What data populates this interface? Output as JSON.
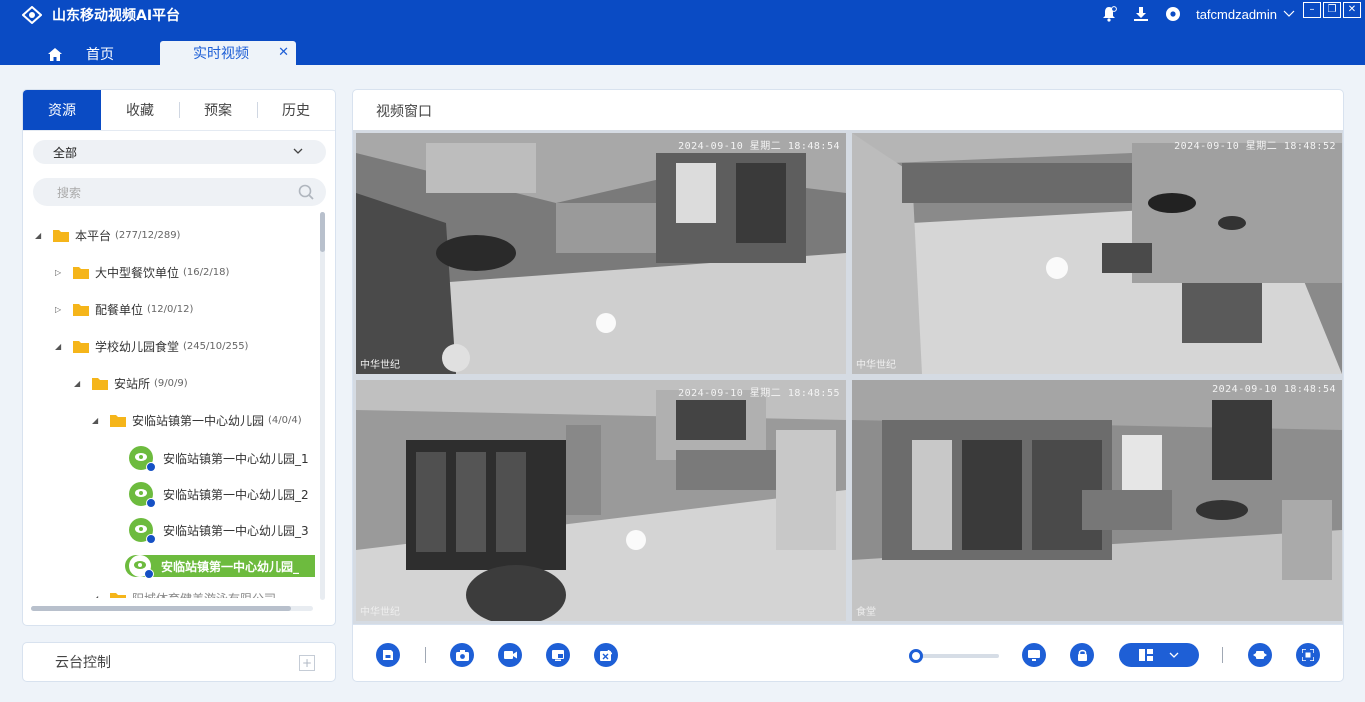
{
  "app": {
    "title": "山东移动视频AI平台",
    "username": "tafcmdzadmin"
  },
  "colors": {
    "brand": "#0a4bc4",
    "accent": "#1e5fd6",
    "selected": "#6dbb3e"
  },
  "tabs": {
    "home_label": "首页",
    "active_label": "实时视频",
    "close_glyph": "✕"
  },
  "left": {
    "tabs": [
      "资源",
      "收藏",
      "预案",
      "历史"
    ],
    "filter_value": "全部",
    "search_placeholder": "搜索",
    "tree": {
      "root": {
        "label": "本平台",
        "count": "(277/12/289)"
      },
      "n1": {
        "label": "大中型餐饮单位",
        "count": "(16/2/18)"
      },
      "n2": {
        "label": "配餐单位",
        "count": "(12/0/12)"
      },
      "n3": {
        "label": "学校幼儿园食堂",
        "count": "(245/10/255)"
      },
      "n4": {
        "label": "安站所",
        "count": "(9/0/9)"
      },
      "n5": {
        "label": "安临站镇第一中心幼儿园",
        "count": "(4/0/4)"
      },
      "cams": [
        "安临站镇第一中心幼儿园_1",
        "安临站镇第一中心幼儿园_2",
        "安临站镇第一中心幼儿园_3",
        "安临站镇第一中心幼儿园_"
      ],
      "partial": "阳城体育健美游泳有限公司"
    },
    "ptz_label": "云台控制"
  },
  "right": {
    "title": "视频窗口",
    "videos": [
      {
        "timestamp": "2024-09-10 星期二 18:48:54",
        "label": "中华世纪"
      },
      {
        "timestamp": "2024-09-10 星期二 18:48:52",
        "label": "中华世纪"
      },
      {
        "timestamp": "2024-09-10 星期二 18:48:55",
        "label": "中华世纪"
      },
      {
        "timestamp": "2024-09-10 18:48:54",
        "label": "食堂"
      }
    ]
  }
}
